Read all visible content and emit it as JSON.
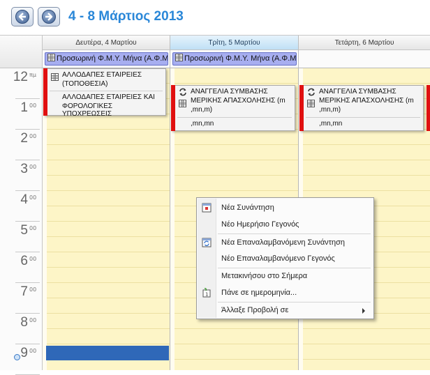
{
  "header": {
    "title": "4 - 8 Μάρτιος 2013"
  },
  "days": [
    {
      "label": "Δευτέρα, 4 Μαρτίου",
      "today": false
    },
    {
      "label": "Τρίτη, 5 Μαρτίου",
      "today": true
    },
    {
      "label": "Τετάρτη, 6 Μαρτίου",
      "today": false
    }
  ],
  "allday_event": {
    "title": "Προσωρινή Φ.Μ.Υ. Μήνα (Α.Φ.Μ"
  },
  "hours": [
    {
      "num": "12",
      "ampm": "πμ"
    },
    {
      "num": "1",
      "ampm": "00"
    },
    {
      "num": "2",
      "ampm": "00"
    },
    {
      "num": "3",
      "ampm": "00"
    },
    {
      "num": "4",
      "ampm": "00"
    },
    {
      "num": "5",
      "ampm": "00"
    },
    {
      "num": "6",
      "ampm": "00"
    },
    {
      "num": "7",
      "ampm": "00"
    },
    {
      "num": "8",
      "ampm": "00"
    },
    {
      "num": "9",
      "ampm": "00"
    }
  ],
  "events": {
    "monday": {
      "line1": "ΑΛΛΟΔΑΠΕΣ ΕΤΑΙΡΕΙΕΣ",
      "line2": "(ΤΟΠΟΘΕΣΙΑ)",
      "line3": "ΑΛΛΟΔΑΠΕΣ ΕΤΑΙΡΕΙΕΣ ΚΑΙ",
      "line4": "ΦΟΡΟΛΟΓΙΚΕΣ ΥΠΟΧΡΕΩΣΕΙΣ"
    },
    "recurring": {
      "line1": "ΑΝΑΓΓΕΛΙΑ ΣΥΜΒΑΣΗΣ",
      "line2": "ΜΕΡΙΚΗΣ ΑΠΑΣΧΟΛΗΣΗΣ (m",
      "line3": ",mn,m)",
      "line4": ",mn,mn"
    }
  },
  "context_menu": {
    "new_appointment": "Νέα Συνάντηση",
    "new_daily_event": "Νέο Ημερήσιο Γεγονός",
    "new_recurring_appointment": "Νέα Επαναλαμβανόμενη Συνάντηση",
    "new_recurring_event": "Νέο Επαναλαμβανόμενο Γεγονός",
    "go_today": "Μετακινήσου στο Σήμερα",
    "go_to_date": "Πάνε σε ημερομηνία...",
    "change_view": "Άλλαξε Προβολή σε"
  },
  "colors": {
    "title": "#2a87d8",
    "event_bar": "#e01010",
    "allday": "#a7aef0",
    "selection": "#2f68b8"
  }
}
